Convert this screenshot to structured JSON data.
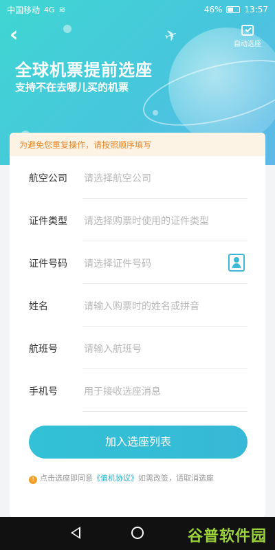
{
  "status_bar": {
    "carrier": "中国移动",
    "signal": "4G",
    "battery": "46%",
    "time": "13:57"
  },
  "header": {
    "back_icon": "back-arrow-icon",
    "auto_select_label": "自动选座",
    "title": "全球机票提前选座",
    "subtitle": "支持不在去哪儿买的机票"
  },
  "notice": "为避免您重复操作，请按照顺序填写",
  "form": {
    "fields": [
      {
        "label": "航空公司",
        "placeholder": "请选择航空公司"
      },
      {
        "label": "证件类型",
        "placeholder": "请选择购票时使用的证件类型"
      },
      {
        "label": "证件号码",
        "placeholder": "请选择证件号码"
      },
      {
        "label": "姓名",
        "placeholder": "请输入购票时的姓名或拼音"
      },
      {
        "label": "航班号",
        "placeholder": "请输入航班号"
      },
      {
        "label": "手机号",
        "placeholder": "用于接收选座消息"
      }
    ],
    "submit_label": "加入选座列表"
  },
  "agreement": {
    "prefix": "点击选座即同意",
    "link": "《值机协议》",
    "suffix": "如需改签，请取消选座"
  },
  "watermark": "谷普软件园",
  "colors": {
    "accent": "#32c1d6",
    "notice_text": "#e9872a"
  }
}
